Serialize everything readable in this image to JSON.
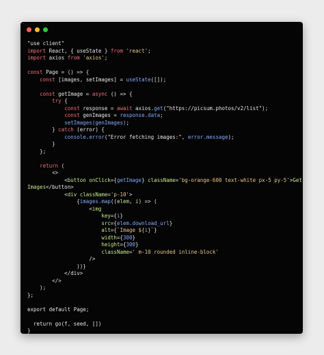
{
  "window": {
    "colors": {
      "background": "#050505",
      "dot_red": "#ff5f56",
      "dot_yellow": "#ffbd2e",
      "dot_green": "#27c93f",
      "keyword": "#f07178",
      "string": "#e7c787",
      "function": "#82aaff",
      "jsx": "#c3e88d",
      "plain": "#e6e6e6"
    }
  },
  "code": {
    "lines": [
      [
        {
          "t": "\"use client\"",
          "c": "plain"
        }
      ],
      [
        {
          "t": "import",
          "c": "kw"
        },
        {
          "t": " React, { useState } ",
          "c": "plain"
        },
        {
          "t": "from",
          "c": "kw"
        },
        {
          "t": " ",
          "c": "plain"
        },
        {
          "t": "'react'",
          "c": "str"
        },
        {
          "t": ";",
          "c": "plain"
        }
      ],
      [
        {
          "t": "import",
          "c": "kw"
        },
        {
          "t": " axios ",
          "c": "plain"
        },
        {
          "t": "from",
          "c": "kw"
        },
        {
          "t": " ",
          "c": "plain"
        },
        {
          "t": "'axios'",
          "c": "str"
        },
        {
          "t": ";",
          "c": "plain"
        }
      ],
      [],
      [
        {
          "t": "const",
          "c": "kw"
        },
        {
          "t": " Page = () => {",
          "c": "plain"
        }
      ],
      [
        {
          "t": "    ",
          "c": "plain"
        },
        {
          "t": "const",
          "c": "kw"
        },
        {
          "t": " [images, setImages] = ",
          "c": "plain"
        },
        {
          "t": "useState",
          "c": "fn"
        },
        {
          "t": "([]);",
          "c": "plain"
        }
      ],
      [],
      [
        {
          "t": "    ",
          "c": "plain"
        },
        {
          "t": "const",
          "c": "kw"
        },
        {
          "t": " getImage = ",
          "c": "plain"
        },
        {
          "t": "async",
          "c": "kw"
        },
        {
          "t": " () => {",
          "c": "plain"
        }
      ],
      [
        {
          "t": "        ",
          "c": "plain"
        },
        {
          "t": "try",
          "c": "kw"
        },
        {
          "t": " {",
          "c": "plain"
        }
      ],
      [
        {
          "t": "            ",
          "c": "plain"
        },
        {
          "t": "const",
          "c": "kw"
        },
        {
          "t": " response = ",
          "c": "plain"
        },
        {
          "t": "await",
          "c": "kw"
        },
        {
          "t": " axios.",
          "c": "plain"
        },
        {
          "t": "get",
          "c": "fn"
        },
        {
          "t": "(\"https://picsum.photos/v2/list\");",
          "c": "plain"
        }
      ],
      [
        {
          "t": "            ",
          "c": "plain"
        },
        {
          "t": "const",
          "c": "kw"
        },
        {
          "t": " genImages = ",
          "c": "plain"
        },
        {
          "t": "response.data",
          "c": "fn"
        },
        {
          "t": ";",
          "c": "plain"
        }
      ],
      [
        {
          "t": "            ",
          "c": "plain"
        },
        {
          "t": "setImages(genImages)",
          "c": "fn"
        },
        {
          "t": ";",
          "c": "plain"
        }
      ],
      [
        {
          "t": "        } ",
          "c": "plain"
        },
        {
          "t": "catch",
          "c": "kw"
        },
        {
          "t": " (error) {",
          "c": "plain"
        }
      ],
      [
        {
          "t": "            ",
          "c": "plain"
        },
        {
          "t": "console",
          "c": "fn"
        },
        {
          "t": ".",
          "c": "plain"
        },
        {
          "t": "error",
          "c": "fn"
        },
        {
          "t": "(\"Error fetching images:\", ",
          "c": "plain"
        },
        {
          "t": "error.message",
          "c": "fn"
        },
        {
          "t": ");",
          "c": "plain"
        }
      ],
      [
        {
          "t": "        }",
          "c": "plain"
        }
      ],
      [
        {
          "t": "    };",
          "c": "plain"
        }
      ],
      [],
      [
        {
          "t": "    ",
          "c": "plain"
        },
        {
          "t": "return",
          "c": "kw"
        },
        {
          "t": " (",
          "c": "plain"
        }
      ],
      [
        {
          "t": "        <>",
          "c": "plain"
        }
      ],
      [
        {
          "t": "            <",
          "c": "plain"
        },
        {
          "t": "button",
          "c": "jsx"
        },
        {
          "t": " ",
          "c": "plain"
        },
        {
          "t": "onClick",
          "c": "jsx"
        },
        {
          "t": "={",
          "c": "plain"
        },
        {
          "t": "getImage",
          "c": "fn"
        },
        {
          "t": "} ",
          "c": "plain"
        },
        {
          "t": "className",
          "c": "jsx"
        },
        {
          "t": "=",
          "c": "plain"
        },
        {
          "t": "'bg-orange-600 text-white px-5 py-5'",
          "c": "str"
        },
        {
          "t": ">",
          "c": "plain"
        },
        {
          "t": "Get",
          "c": "jsx"
        }
      ],
      [
        {
          "t": "Images",
          "c": "jsx"
        },
        {
          "t": "</button>",
          "c": "plain"
        }
      ],
      [
        {
          "t": "            <",
          "c": "plain"
        },
        {
          "t": "div",
          "c": "jsx"
        },
        {
          "t": " ",
          "c": "plain"
        },
        {
          "t": "className",
          "c": "jsx"
        },
        {
          "t": "=",
          "c": "plain"
        },
        {
          "t": "'p-10'",
          "c": "str"
        },
        {
          "t": ">",
          "c": "plain"
        }
      ],
      [
        {
          "t": "                {",
          "c": "plain"
        },
        {
          "t": "images.map",
          "c": "fn"
        },
        {
          "t": "((",
          "c": "plain"
        },
        {
          "t": "elem",
          "c": "jsx"
        },
        {
          "t": ", ",
          "c": "plain"
        },
        {
          "t": "i",
          "c": "jsx"
        },
        {
          "t": ") => (",
          "c": "plain"
        }
      ],
      [
        {
          "t": "                    <",
          "c": "plain"
        },
        {
          "t": "img",
          "c": "jsx"
        }
      ],
      [
        {
          "t": "                        ",
          "c": "plain"
        },
        {
          "t": "key",
          "c": "jsx"
        },
        {
          "t": "={",
          "c": "plain"
        },
        {
          "t": "i",
          "c": "fn"
        },
        {
          "t": "}",
          "c": "plain"
        }
      ],
      [
        {
          "t": "                        ",
          "c": "plain"
        },
        {
          "t": "src",
          "c": "jsx"
        },
        {
          "t": "={",
          "c": "plain"
        },
        {
          "t": "elem.download_url",
          "c": "fn"
        },
        {
          "t": "}",
          "c": "plain"
        }
      ],
      [
        {
          "t": "                        ",
          "c": "plain"
        },
        {
          "t": "alt",
          "c": "jsx"
        },
        {
          "t": "={`",
          "c": "plain"
        },
        {
          "t": "Image ${",
          "c": "str"
        },
        {
          "t": "i",
          "c": "fn"
        },
        {
          "t": "}",
          "c": "str"
        },
        {
          "t": "`}",
          "c": "plain"
        }
      ],
      [
        {
          "t": "                        ",
          "c": "plain"
        },
        {
          "t": "width",
          "c": "jsx"
        },
        {
          "t": "={",
          "c": "plain"
        },
        {
          "t": "300",
          "c": "fn"
        },
        {
          "t": "}",
          "c": "plain"
        }
      ],
      [
        {
          "t": "                        ",
          "c": "plain"
        },
        {
          "t": "height",
          "c": "jsx"
        },
        {
          "t": "={",
          "c": "plain"
        },
        {
          "t": "300",
          "c": "fn"
        },
        {
          "t": "}",
          "c": "plain"
        }
      ],
      [
        {
          "t": "                        ",
          "c": "plain"
        },
        {
          "t": "className",
          "c": "jsx"
        },
        {
          "t": "=",
          "c": "plain"
        },
        {
          "t": "' m-10 rounded inline-block'",
          "c": "str"
        }
      ],
      [
        {
          "t": "                    />",
          "c": "plain"
        }
      ],
      [
        {
          "t": "                ))}",
          "c": "plain"
        }
      ],
      [
        {
          "t": "            </div>",
          "c": "plain"
        }
      ],
      [
        {
          "t": "        </>",
          "c": "plain"
        }
      ],
      [
        {
          "t": "    );",
          "c": "plain"
        }
      ],
      [
        {
          "t": "};",
          "c": "plain"
        }
      ],
      [],
      [
        {
          "t": "export default Page;",
          "c": "plain"
        }
      ],
      [],
      [
        {
          "t": "  return go(f, seed, [])",
          "c": "plain"
        }
      ],
      [
        {
          "t": "}",
          "c": "plain"
        }
      ]
    ]
  }
}
